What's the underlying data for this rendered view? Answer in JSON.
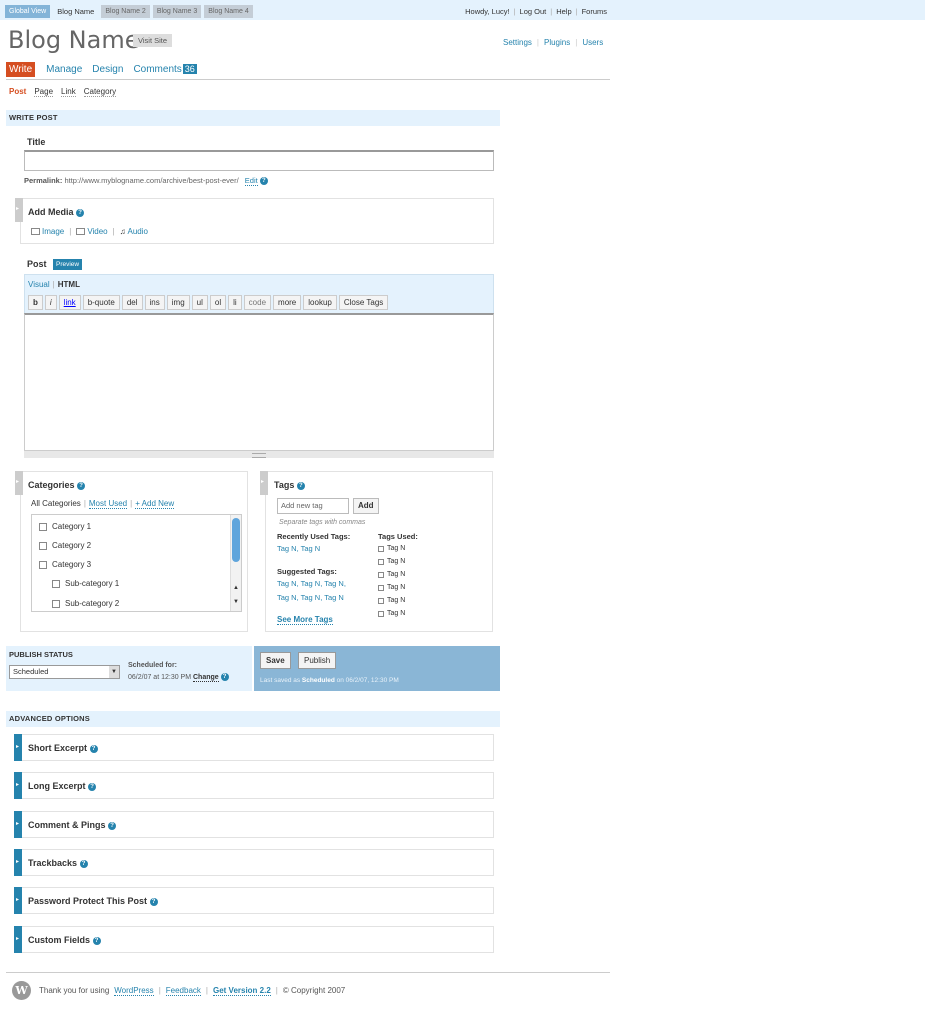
{
  "blog_tabs": [
    {
      "label": "Global View",
      "kind": "global"
    },
    {
      "label": "Blog Name",
      "kind": "active"
    },
    {
      "label": "Blog Name 2",
      "kind": "normal"
    },
    {
      "label": "Blog Name 3",
      "kind": "normal"
    },
    {
      "label": "Blog Name 4",
      "kind": "normal"
    }
  ],
  "user": {
    "greeting_prefix": "Howdy, ",
    "name": "Lucy",
    "greeting_suffix": "!",
    "logout": "Log Out",
    "help": "Help",
    "forums": "Forums"
  },
  "header": {
    "blog_title": "Blog Name",
    "visit_site": "Visit Site",
    "right_links": [
      "Settings",
      "Plugins",
      "Users"
    ]
  },
  "main_menu": {
    "write": "Write",
    "manage": "Manage",
    "design": "Design",
    "comments": "Comments",
    "comments_count": "36"
  },
  "sub_menu": [
    "Post",
    "Page",
    "Link",
    "Category"
  ],
  "write_post": {
    "section_title": "WRITE POST",
    "title_label": "Title",
    "title_value": "",
    "permalink_label": "Permalink:",
    "permalink_url": "http://www.myblogname.com/archive/best-post-ever/",
    "permalink_edit": "Edit"
  },
  "add_media": {
    "title": "Add Media",
    "links": [
      "Image",
      "Video",
      "Audio"
    ]
  },
  "post_editor": {
    "label": "Post",
    "preview": "Preview",
    "mode_visual": "Visual",
    "mode_html": "HTML",
    "quicktags": [
      "b",
      "i",
      "link",
      "b-quote",
      "del",
      "ins",
      "img",
      "ul",
      "ol",
      "li",
      "code",
      "more",
      "lookup",
      "Close Tags"
    ],
    "content": ""
  },
  "categories": {
    "title": "Categories",
    "tab_all": "All Categories",
    "tab_most_used": "Most Used",
    "tab_add_new": "+ Add New",
    "items": [
      {
        "label": "Category 1",
        "level": 0
      },
      {
        "label": "Category 2",
        "level": 0
      },
      {
        "label": "Category 3",
        "level": 0
      },
      {
        "label": "Sub-category 1",
        "level": 1
      },
      {
        "label": "Sub-category 2",
        "level": 1
      }
    ]
  },
  "tags": {
    "title": "Tags",
    "input_placeholder": "Add new tag",
    "add_button": "Add",
    "hint": "Separate tags with commas",
    "recent_heading": "Recently Used Tags:",
    "recent_line": "Tag N, Tag N",
    "suggested_heading": "Suggested Tags:",
    "suggested_line1": "Tag N, Tag N, Tag N,",
    "suggested_line2": "Tag N, Tag N, Tag N",
    "used_heading": "Tags Used:",
    "used": [
      "Tag N",
      "Tag N",
      "Tag N",
      "Tag N",
      "Tag N",
      "Tag N"
    ],
    "see_more": "See More Tags"
  },
  "publish": {
    "title": "PUBLISH STATUS",
    "status_value": "Scheduled",
    "scheduled_label": "Scheduled for:",
    "scheduled_date": "06/2/07 at 12:30 PM",
    "change": "Change",
    "save": "Save",
    "publish": "Publish",
    "last_saved_prefix": "Last saved as ",
    "last_saved_status": "Scheduled",
    "last_saved_suffix": " on 06/2/07, 12:30 PM"
  },
  "advanced": {
    "title": "ADVANCED OPTIONS",
    "items": [
      "Short Excerpt",
      "Long Excerpt",
      "Comment & Pings",
      "Trackbacks",
      "Password Protect This Post",
      "Custom Fields"
    ]
  },
  "footer": {
    "thanks": "Thank you for using",
    "wordpress": "WordPress",
    "feedback": "Feedback",
    "get_version": "Get Version 2.2",
    "copyright": "© Copyright 2007"
  }
}
